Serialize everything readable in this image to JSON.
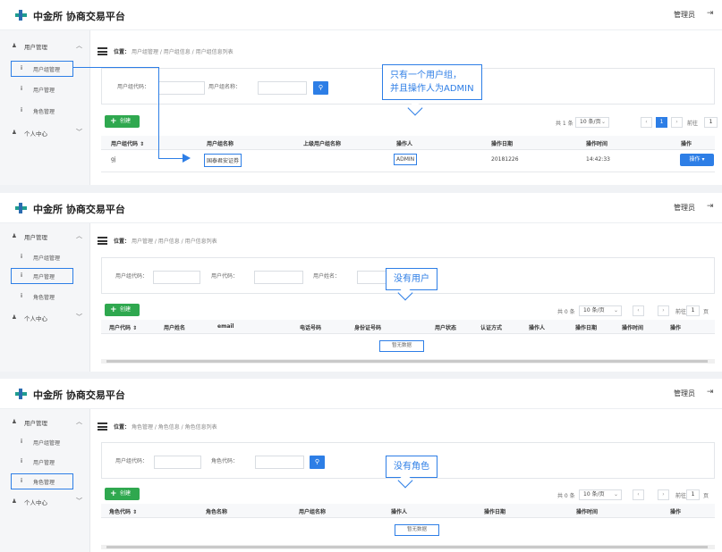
{
  "app": {
    "title": "中金所 协商交易平台",
    "admin": "管理员",
    "logout_icon": "logout-icon"
  },
  "sidebar": {
    "group_user": {
      "label": "用户管理",
      "icon": "users-icon"
    },
    "items": [
      {
        "label": "用户组管理"
      },
      {
        "label": "用户管理"
      },
      {
        "label": "角色管理"
      }
    ],
    "group_personal": {
      "label": "个人中心",
      "icon": "person-icon"
    }
  },
  "panel1": {
    "crumb_prefix": "位置：",
    "crumb": "用户组管理 / 用户组信息 / 用户组信息列表",
    "search": {
      "label1": "用户组代码：",
      "label2": "用户组名称："
    },
    "create": "创建",
    "pager": {
      "total": "共 1 条",
      "size": "10 条/页",
      "page": "1",
      "goto": "前往",
      "goto_page": "1",
      "unit": "页"
    },
    "headers": [
      "用户组代码 ⇕",
      "用户组名称",
      "上级用户组名称",
      "操作人",
      "操作日期",
      "操作时间",
      "操作"
    ],
    "row": {
      "code": "gj",
      "name": "国泰君安证券",
      "parent": "",
      "operator": "ADMIN",
      "date": "20181226",
      "time": "14:42:33",
      "action": "操作 ▾"
    },
    "callout": [
      "只有一个用户组，",
      "并且操作人为ADMIN"
    ]
  },
  "panel2": {
    "crumb_prefix": "位置：",
    "crumb": "用户管理 / 用户信息 / 用户信息列表",
    "search": {
      "label1": "用户组代码：",
      "label2": "用户代码：",
      "label3": "用户姓名："
    },
    "create": "创建",
    "pager": {
      "total": "共 0 条",
      "size": "10 条/页",
      "goto": "前往",
      "goto_page": "1",
      "unit": "页"
    },
    "headers": [
      "用户代码 ⇕",
      "用户姓名",
      "email",
      "电话号码",
      "身份证号码",
      "用户状态",
      "认证方式",
      "操作人",
      "操作日期",
      "操作时间",
      "操作"
    ],
    "empty": "暂无数据",
    "callout": [
      "没有用户"
    ]
  },
  "panel3": {
    "crumb_prefix": "位置：",
    "crumb": "角色管理 / 角色信息 / 角色信息列表",
    "search": {
      "label1": "用户组代码：",
      "label2": "角色代码："
    },
    "create": "创建",
    "pager": {
      "total": "共 0 条",
      "size": "10 条/页",
      "goto": "前往",
      "goto_page": "1",
      "unit": "页"
    },
    "headers": [
      "角色代码 ⇕",
      "角色名称",
      "用户组名称",
      "操作人",
      "操作日期",
      "操作时间",
      "操作"
    ],
    "empty": "暂无数据",
    "callout": [
      "没有角色"
    ]
  },
  "colors": {
    "accent": "#2d7ee6",
    "create": "#2fa84f",
    "callout": "#2d7ee6"
  }
}
